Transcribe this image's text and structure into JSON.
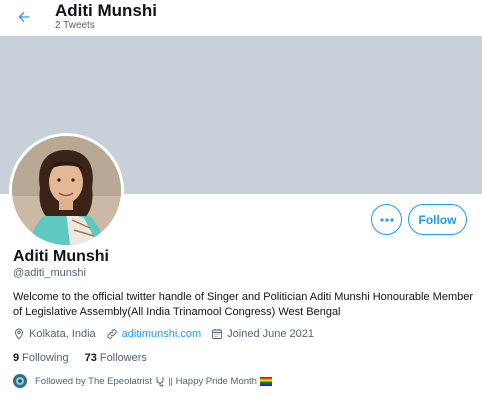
{
  "header": {
    "name": "Aditi Munshi",
    "tweet_count": "2 Tweets"
  },
  "profile": {
    "display_name": "Aditi Munshi",
    "handle": "@aditi_munshi",
    "bio": "Welcome to the official twitter handle of Singer and Politician Aditi Munshi Honourable Member of Legislative Assembly(All India Trinamool Congress) West Bengal",
    "location": "Kolkata, India",
    "website": "aditimunshi.com",
    "joined": "Joined June 2021",
    "follow_label": "Follow"
  },
  "stats": {
    "following_count": "9",
    "following_label": "Following",
    "followers_count": "73",
    "followers_label": "Followers"
  },
  "followed_by": {
    "prefix": "Followed by The Epeolatrist",
    "suffix": "|| Happy Pride Month"
  },
  "colors": {
    "accent": "#1d9bf0",
    "banner": "#c8d1d9",
    "secondary_text": "#536471"
  }
}
